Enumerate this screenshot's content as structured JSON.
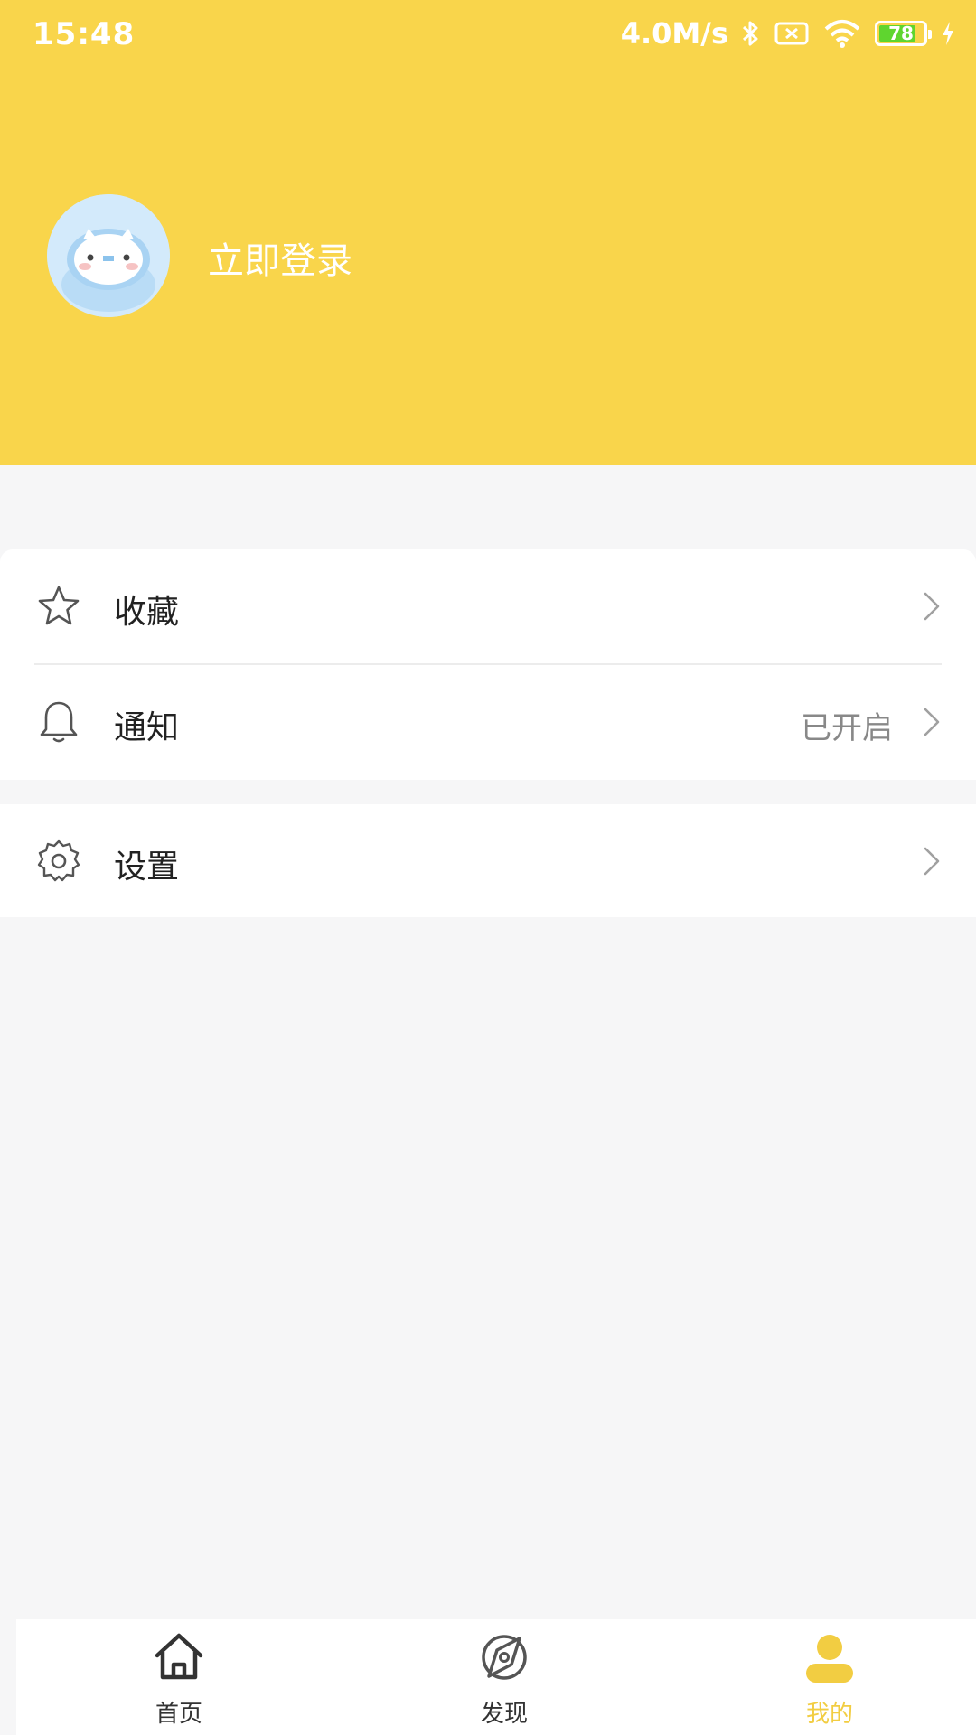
{
  "status_bar": {
    "time": "15:48",
    "net_speed": "4.0M/s",
    "battery": "78",
    "icons": [
      "bluetooth-icon",
      "sim-off-icon",
      "wifi-icon",
      "battery-icon",
      "charging-icon"
    ]
  },
  "header": {
    "login_label": "立即登录",
    "background_color": "#f9d54b"
  },
  "menu": {
    "favorites_label": "收藏",
    "notifications_label": "通知",
    "notifications_value": "已开启",
    "settings_label": "设置"
  },
  "tabbar": {
    "home_label": "首页",
    "discover_label": "发现",
    "mine_label": "我的",
    "active_color": "#f2cd42"
  }
}
